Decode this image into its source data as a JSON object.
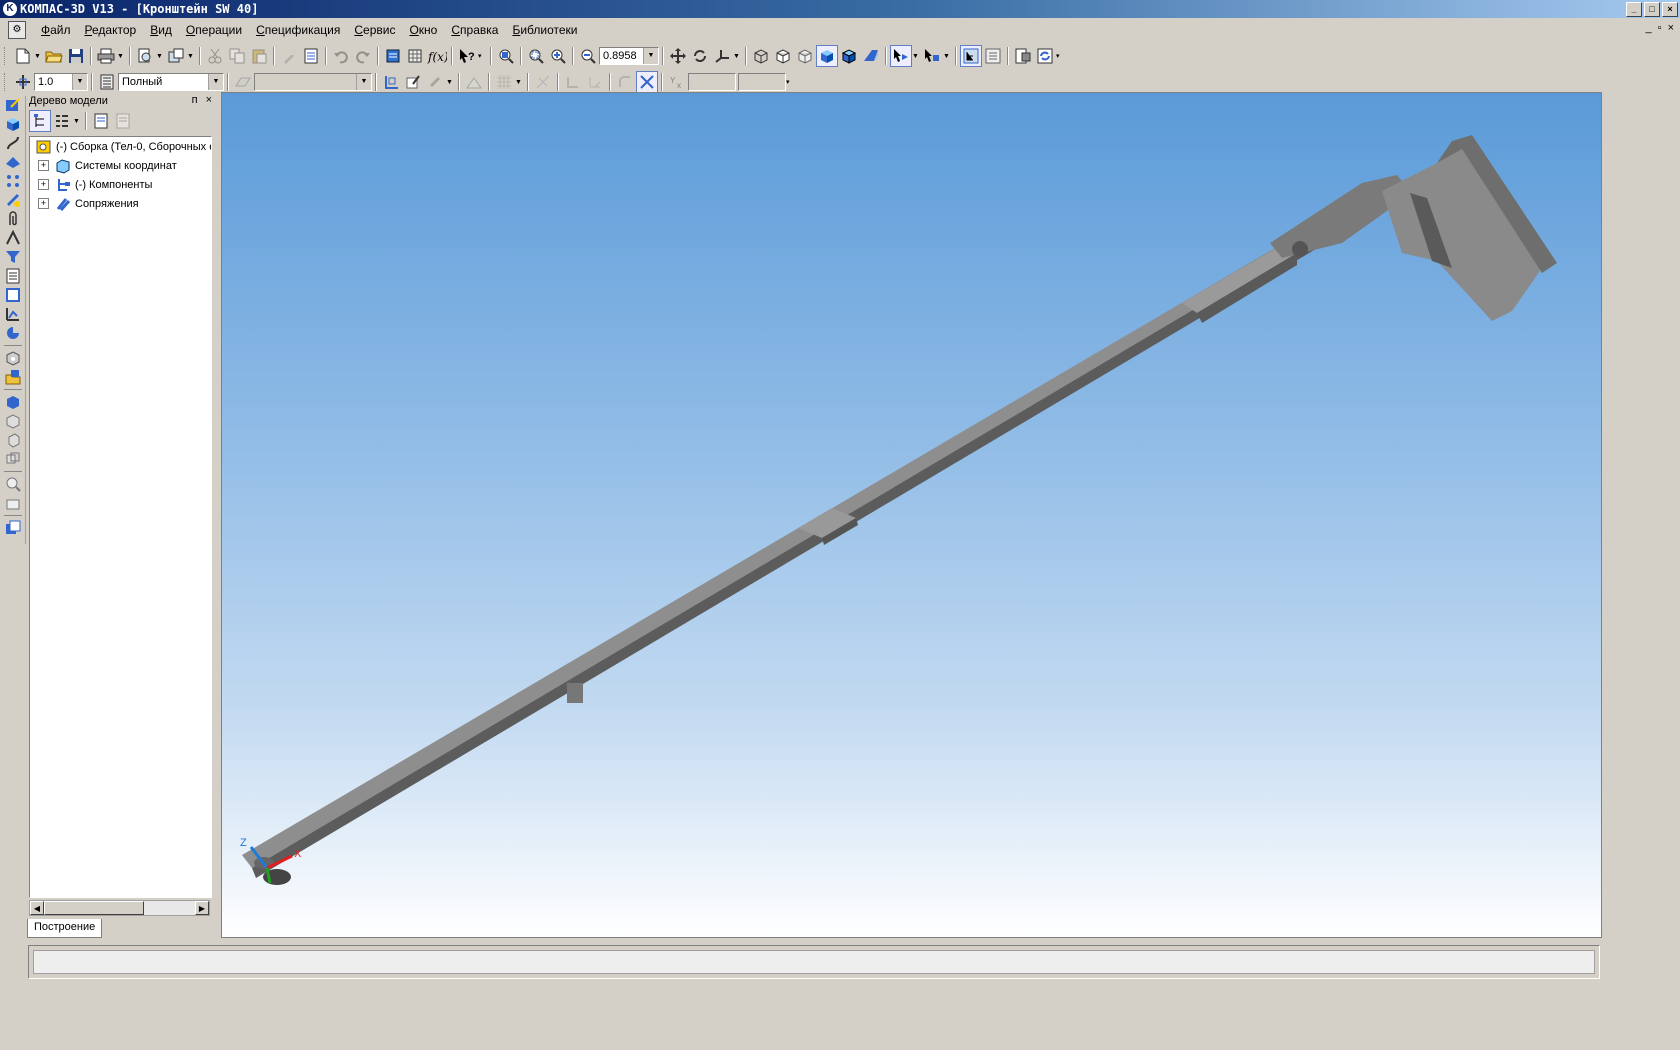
{
  "window": {
    "title": "КОМПАС-3D V13 - [Кронштейн SW 40]",
    "controls": [
      "_",
      "□",
      "×"
    ]
  },
  "menu": [
    {
      "first": "Ф",
      "rest": "айл"
    },
    {
      "first": "Р",
      "rest": "едактор"
    },
    {
      "first": "В",
      "rest": "ид"
    },
    {
      "first": "О",
      "rest": "перации"
    },
    {
      "first": "С",
      "rest": "пецификация"
    },
    {
      "first": "С",
      "rest": "ервис"
    },
    {
      "first": "О",
      "rest": "кно"
    },
    {
      "first": "С",
      "rest": "правка"
    },
    {
      "first": "Б",
      "rest": "иблиотеки"
    }
  ],
  "mdi_controls": [
    "_",
    "▫",
    "×"
  ],
  "toolbar": {
    "zoom_value": "0.8958",
    "step_value": "1.0",
    "render_mode": "Полный"
  },
  "panel": {
    "title": "Дерево модели",
    "pin": "ᴨ",
    "close": "×",
    "tab_label": "Построение"
  },
  "tree": [
    {
      "label": "(-) Сборка (Тел-0, Сборочных е",
      "expandable": false,
      "icon": "assembly-icon"
    },
    {
      "label": "Системы координат",
      "expandable": true,
      "icon": "coordinate-systems-icon"
    },
    {
      "label": "(-) Компоненты",
      "expandable": true,
      "icon": "components-icon"
    },
    {
      "label": "Сопряжения",
      "expandable": true,
      "icon": "mates-icon"
    }
  ],
  "axes": {
    "x": "X",
    "z": "Z"
  },
  "colors": {
    "title_start": "#0a246a",
    "title_end": "#a6caf0",
    "viewport_top": "#5a9ad8",
    "viewport_bottom": "#ffffff",
    "model": "#8a8a8a"
  }
}
